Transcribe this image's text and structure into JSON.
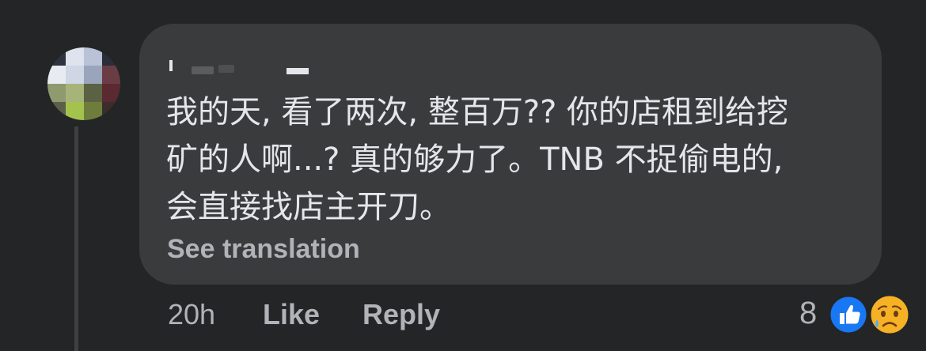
{
  "comment": {
    "lines": [
      "我的天, 看了两次, 整百万?? 你的店租到给挖",
      "矿的人啊...? 真的够力了。TNB 不捉偷电的,",
      "会直接找店主开刀。"
    ],
    "see_translation": "See translation"
  },
  "actions": {
    "time": "20h",
    "like": "Like",
    "reply": "Reply"
  },
  "reactions": {
    "count": "8",
    "icons": [
      "like-icon",
      "sad-icon"
    ]
  },
  "colors": {
    "background": "#242526",
    "bubble": "#3a3b3c",
    "text": "#e4e6eb",
    "secondary_text": "#b0b3b8",
    "like_blue": "#1877f2",
    "sad_yellow": "#f7b125"
  }
}
